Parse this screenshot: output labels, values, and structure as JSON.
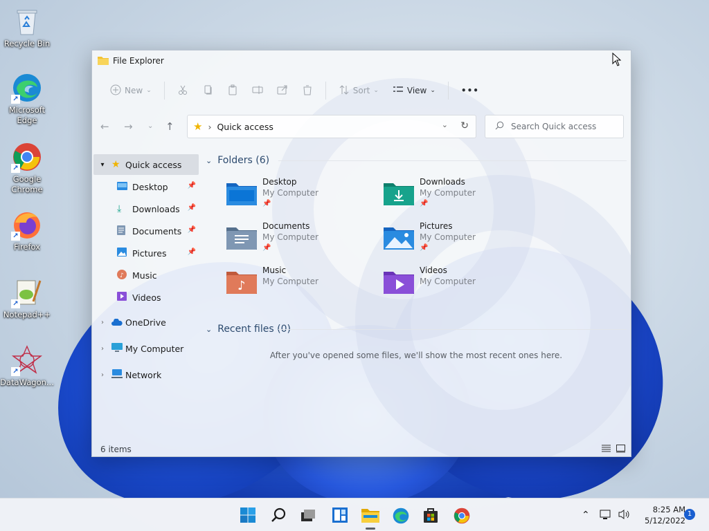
{
  "desktop": {
    "icons": [
      {
        "label": "Recycle Bin",
        "icon": "recycle-bin-icon"
      },
      {
        "label": "Microsoft\nEdge",
        "icon": "edge-icon"
      },
      {
        "label": "Google\nChrome",
        "icon": "chrome-icon"
      },
      {
        "label": "Firefox",
        "icon": "firefox-icon"
      },
      {
        "label": "Notepad++",
        "icon": "notepadpp-icon"
      },
      {
        "label": "DataWagon...",
        "icon": "datawagon-icon"
      }
    ]
  },
  "window": {
    "title": "File Explorer",
    "toolbar": {
      "new_label": "New",
      "sort_label": "Sort",
      "view_label": "View",
      "more_label": "•••"
    },
    "address": {
      "path": "Quick access",
      "separator": "›"
    },
    "search": {
      "placeholder": "Search Quick access"
    },
    "sidebar": {
      "quick_access": "Quick access",
      "pinned": [
        {
          "label": "Desktop",
          "pinned": true
        },
        {
          "label": "Downloads",
          "pinned": true
        },
        {
          "label": "Documents",
          "pinned": true
        },
        {
          "label": "Pictures",
          "pinned": true
        },
        {
          "label": "Music",
          "pinned": false
        },
        {
          "label": "Videos",
          "pinned": false
        }
      ],
      "onedrive": "OneDrive",
      "my_computer": "My Computer",
      "network": "Network"
    },
    "folders_header": "Folders (6)",
    "folders": [
      {
        "name": "Desktop",
        "location": "My Computer",
        "pinned": true,
        "color": "#1e7fd8"
      },
      {
        "name": "Downloads",
        "location": "My Computer",
        "pinned": true,
        "color": "#17a38c"
      },
      {
        "name": "Documents",
        "location": "My Computer",
        "pinned": true,
        "color": "#6e8aa8"
      },
      {
        "name": "Pictures",
        "location": "My Computer",
        "pinned": true,
        "color": "#2a8be0"
      },
      {
        "name": "Music",
        "location": "My Computer",
        "pinned": false,
        "color": "#e07a5a"
      },
      {
        "name": "Videos",
        "location": "My Computer",
        "pinned": false,
        "color": "#8a4fd8"
      }
    ],
    "recent_header": "Recent files (0)",
    "recent_message": "After you've opened some files, we'll show the most recent ones here.",
    "status": "6 items"
  },
  "taskbar": {
    "time": "8:25 AM",
    "date": "5/12/2022",
    "notifications": "1"
  }
}
